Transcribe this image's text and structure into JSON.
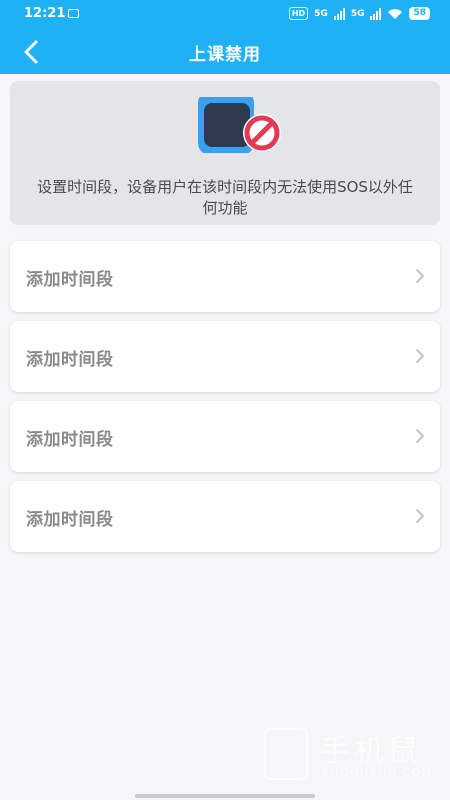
{
  "status_bar": {
    "time": "12:21",
    "hd_label": "HD",
    "sim1": "5G",
    "sim2": "5G",
    "battery": "58"
  },
  "header": {
    "title": "上课禁用",
    "back_icon": "chevron-left-icon"
  },
  "banner": {
    "illustration_icon": "watch-disabled-icon",
    "description": "设置时间段，设备用户在该时间段内无法使用SOS以外任何功能"
  },
  "time_slots": [
    {
      "label": "添加时间段"
    },
    {
      "label": "添加时间段"
    },
    {
      "label": "添加时间段"
    },
    {
      "label": "添加时间段"
    }
  ],
  "watermark": {
    "brand_cn": "手机鼠",
    "brand_en": "SHOUJISHU.COM"
  },
  "colors": {
    "primary": "#1fb1f5",
    "banner_bg": "#e4e5e8",
    "item_text": "#8a8a8a",
    "forbidden_red": "#e23a53"
  }
}
